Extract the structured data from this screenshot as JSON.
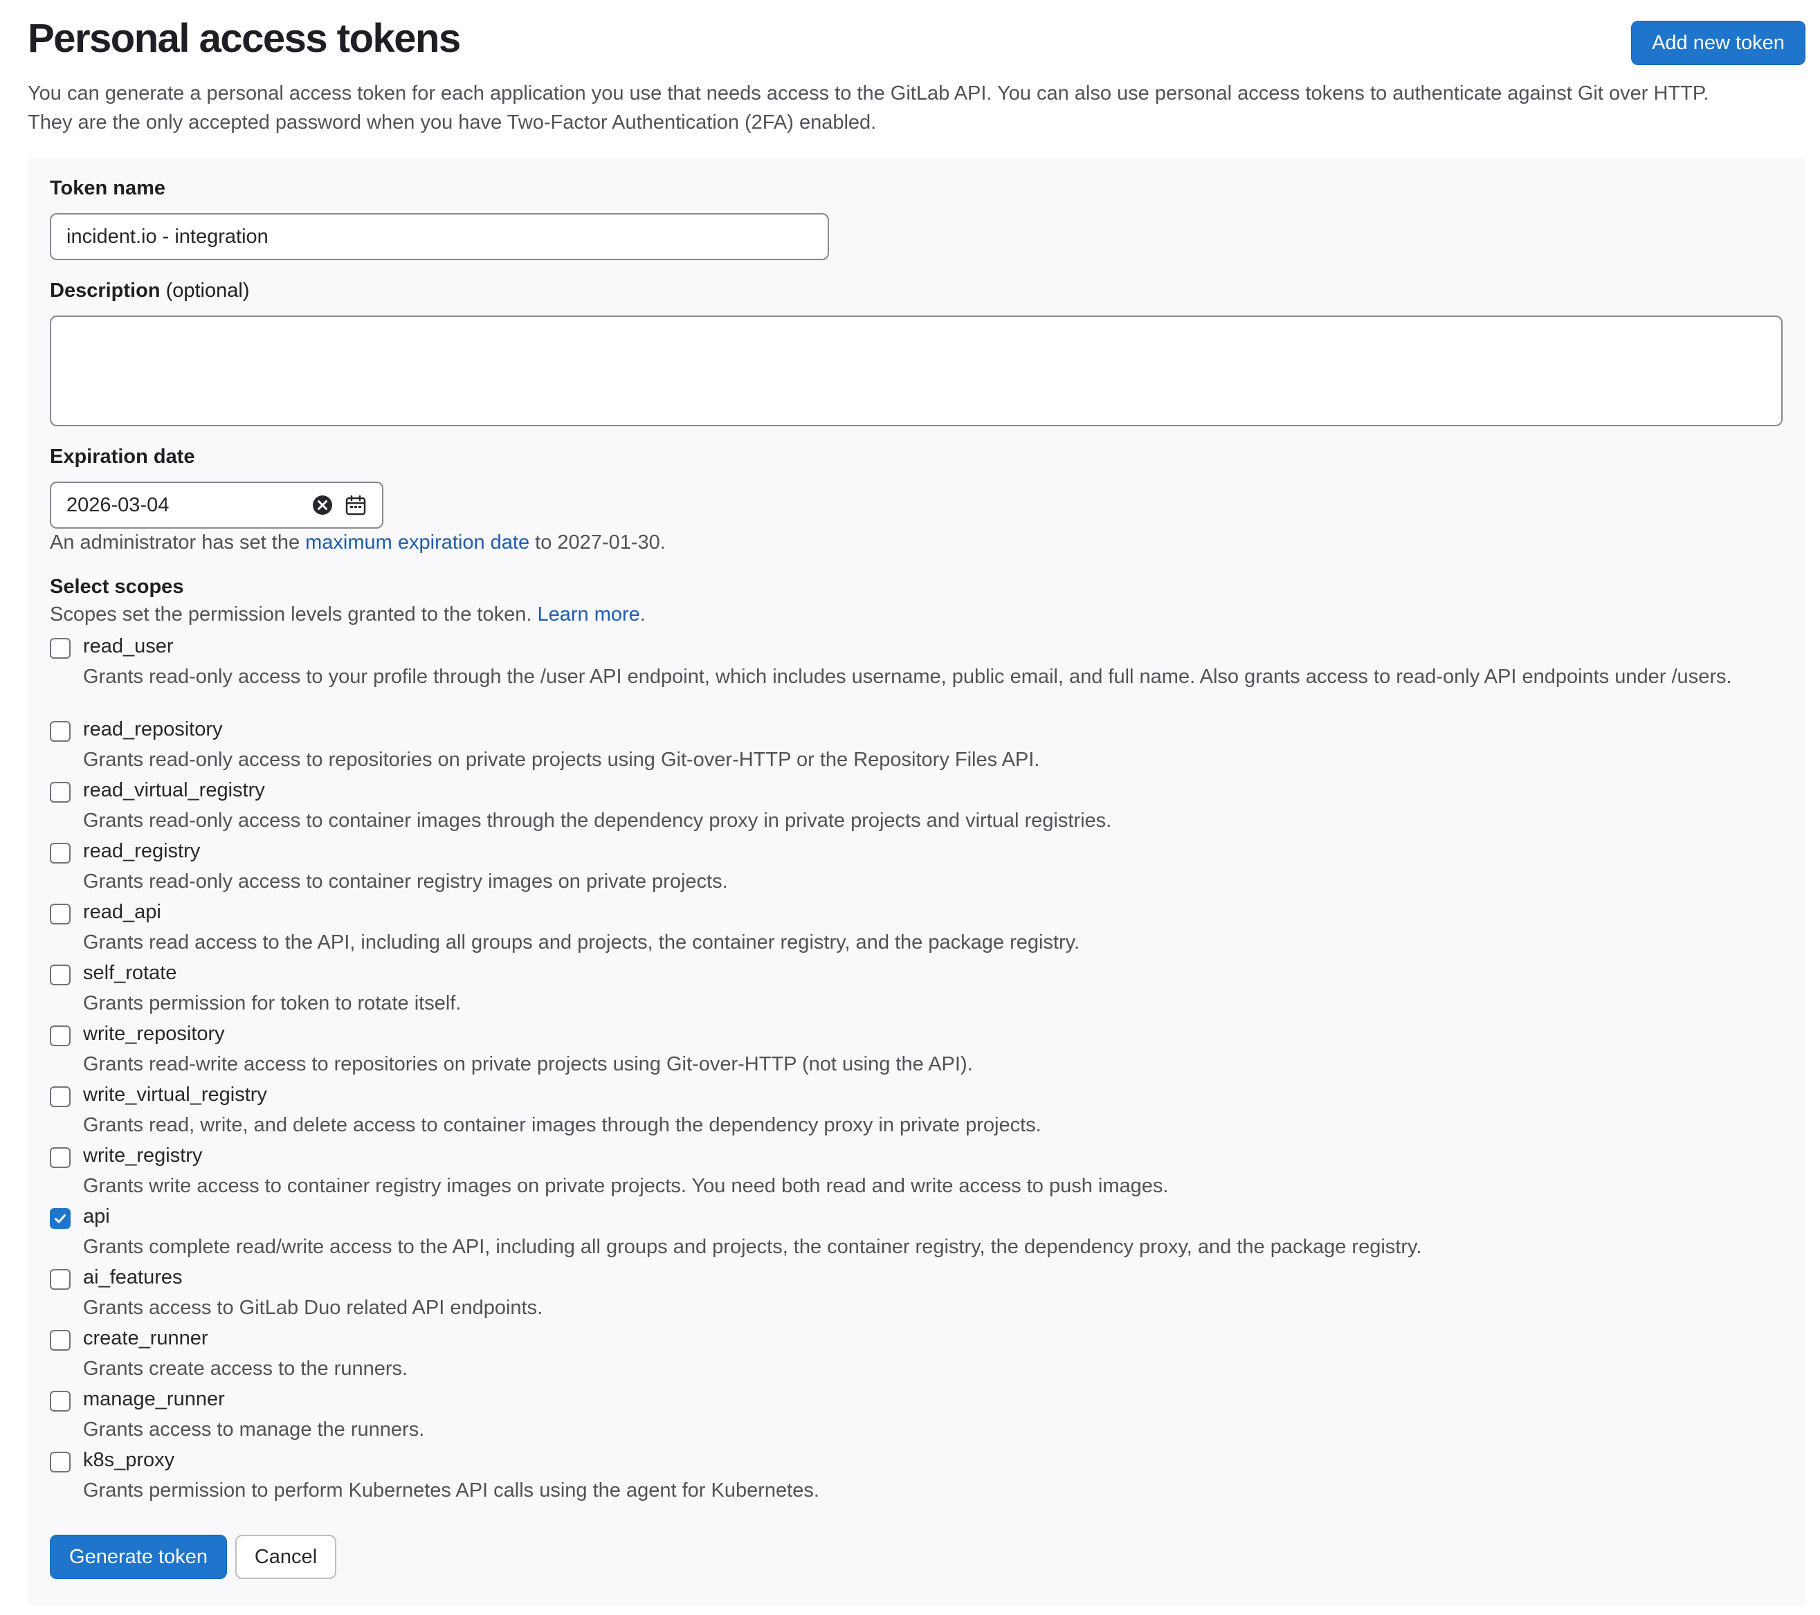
{
  "header": {
    "title": "Personal access tokens",
    "add_button": "Add new token",
    "intro_line1": "You can generate a personal access token for each application you use that needs access to the GitLab API. You can also use personal access tokens to authenticate against Git over HTTP.",
    "intro_line2": "They are the only accepted password when you have Two-Factor Authentication (2FA) enabled."
  },
  "form": {
    "token_name_label": "Token name",
    "token_name_value": "incident.io - integration",
    "description_label": "Description",
    "description_optional": " (optional)",
    "description_value": "",
    "expiration_label": "Expiration date",
    "expiration_value": "2026-03-04",
    "expiration_help_prefix": "An administrator has set the ",
    "expiration_help_link": "maximum expiration date",
    "expiration_help_suffix": " to 2027-01-30.",
    "scopes_label": "Select scopes",
    "scopes_help": "Scopes set the permission levels granted to the token. ",
    "scopes_help_link": "Learn more",
    "scopes_help_end": ".",
    "scopes": [
      {
        "name": "read_user",
        "checked": false,
        "description": "Grants read-only access to your profile through the /user API endpoint, which includes username, public email, and full name. Also grants access to read-only API endpoints under /users."
      },
      {
        "name": "read_repository",
        "checked": false,
        "description": "Grants read-only access to repositories on private projects using Git-over-HTTP or the Repository Files API."
      },
      {
        "name": "read_virtual_registry",
        "checked": false,
        "description": "Grants read-only access to container images through the dependency proxy in private projects and virtual registries."
      },
      {
        "name": "read_registry",
        "checked": false,
        "description": "Grants read-only access to container registry images on private projects."
      },
      {
        "name": "read_api",
        "checked": false,
        "description": "Grants read access to the API, including all groups and projects, the container registry, and the package registry."
      },
      {
        "name": "self_rotate",
        "checked": false,
        "description": "Grants permission for token to rotate itself."
      },
      {
        "name": "write_repository",
        "checked": false,
        "description": "Grants read-write access to repositories on private projects using Git-over-HTTP (not using the API)."
      },
      {
        "name": "write_virtual_registry",
        "checked": false,
        "description": "Grants read, write, and delete access to container images through the dependency proxy in private projects."
      },
      {
        "name": "write_registry",
        "checked": false,
        "description": "Grants write access to container registry images on private projects. You need both read and write access to push images."
      },
      {
        "name": "api",
        "checked": true,
        "description": "Grants complete read/write access to the API, including all groups and projects, the container registry, the dependency proxy, and the package registry."
      },
      {
        "name": "ai_features",
        "checked": false,
        "description": "Grants access to GitLab Duo related API endpoints."
      },
      {
        "name": "create_runner",
        "checked": false,
        "description": "Grants create access to the runners."
      },
      {
        "name": "manage_runner",
        "checked": false,
        "description": "Grants access to manage the runners."
      },
      {
        "name": "k8s_proxy",
        "checked": false,
        "description": "Grants permission to perform Kubernetes API calls using the agent for Kubernetes."
      }
    ],
    "generate_button": "Generate token",
    "cancel_button": "Cancel"
  },
  "icons": {
    "clear": "clear-icon",
    "calendar": "calendar-icon",
    "check": "check-icon"
  },
  "colors": {
    "primary": "#1f75cb",
    "link": "#1f5dad",
    "panel_bg": "#f9f9fb"
  }
}
